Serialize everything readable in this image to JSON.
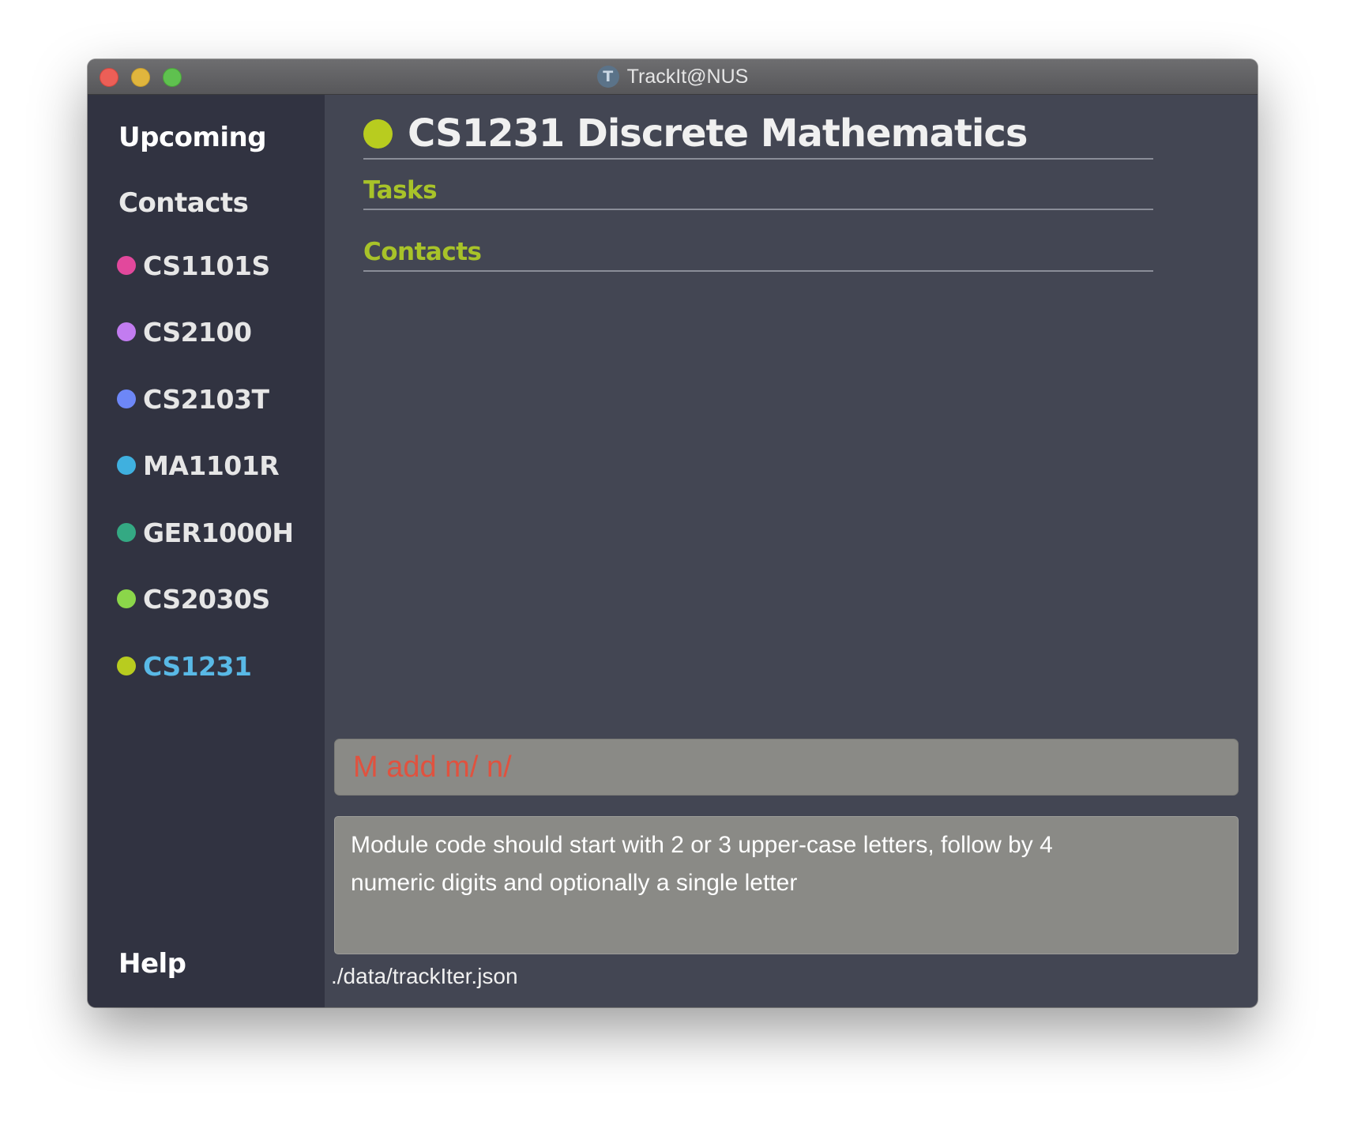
{
  "window": {
    "title": "TrackIt@NUS",
    "app_icon_letter": "T"
  },
  "sidebar": {
    "upcoming_label": "Upcoming",
    "contacts_label": "Contacts",
    "help_label": "Help",
    "modules": [
      {
        "code": "CS1101S",
        "color": "#e2489c",
        "active": false
      },
      {
        "code": "CS2100",
        "color": "#c27cf0",
        "active": false
      },
      {
        "code": "CS2103T",
        "color": "#6d87f7",
        "active": false
      },
      {
        "code": "MA1101R",
        "color": "#3fb0df",
        "active": false
      },
      {
        "code": "GER1000H",
        "color": "#34a983",
        "active": false
      },
      {
        "code": "CS2030S",
        "color": "#8bd64a",
        "active": false
      },
      {
        "code": "CS1231",
        "color": "#b8cc1f",
        "active": true
      }
    ]
  },
  "main": {
    "header_title": "CS1231 Discrete Mathematics",
    "header_dot_color": "#b8cc1f",
    "tasks_label": "Tasks",
    "contacts_label": "Contacts",
    "accent_color": "#a8c329"
  },
  "command_box": {
    "value": "M add m/ n/",
    "text_color": "#e0523f"
  },
  "result_display": {
    "text": "Module code should start with 2 or 3 upper-case letters, follow by 4 numeric digits and optionally a single letter"
  },
  "status_bar": {
    "file_path": "./data/trackIter.json"
  }
}
